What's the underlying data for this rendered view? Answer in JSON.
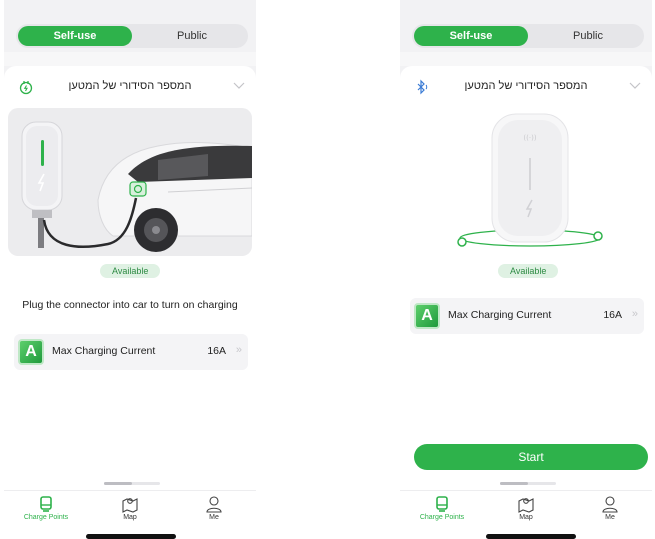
{
  "colors": {
    "accent": "#2eb24b",
    "badge_bg": "#dff1e3",
    "badge_text": "#2e8b44"
  },
  "left": {
    "segment": {
      "self_use": "Self-use",
      "public": "Public"
    },
    "header": {
      "title": "המספר הסידורי של המטען",
      "icon": "charger-plug-icon",
      "chevron": "chevron-down-icon"
    },
    "status": "Available",
    "hint": "Plug the connector into car to turn on charging",
    "max_current": {
      "label": "Max Charging Current",
      "value": "16A",
      "icon_letter": "A"
    },
    "tabs": [
      {
        "label": "Charge Points",
        "icon": "charge-points-icon"
      },
      {
        "label": "Map",
        "icon": "map-icon"
      },
      {
        "label": "Me",
        "icon": "user-icon"
      }
    ]
  },
  "right": {
    "segment": {
      "self_use": "Self-use",
      "public": "Public"
    },
    "header": {
      "title": "המספר הסידורי של המטען",
      "icon": "bluetooth-icon",
      "chevron": "chevron-down-icon"
    },
    "status": "Available",
    "max_current": {
      "label": "Max Charging Current",
      "value": "16A",
      "icon_letter": "A"
    },
    "start_label": "Start",
    "tabs": [
      {
        "label": "Charge Points",
        "icon": "charge-points-icon"
      },
      {
        "label": "Map",
        "icon": "map-icon"
      },
      {
        "label": "Me",
        "icon": "user-icon"
      }
    ]
  }
}
